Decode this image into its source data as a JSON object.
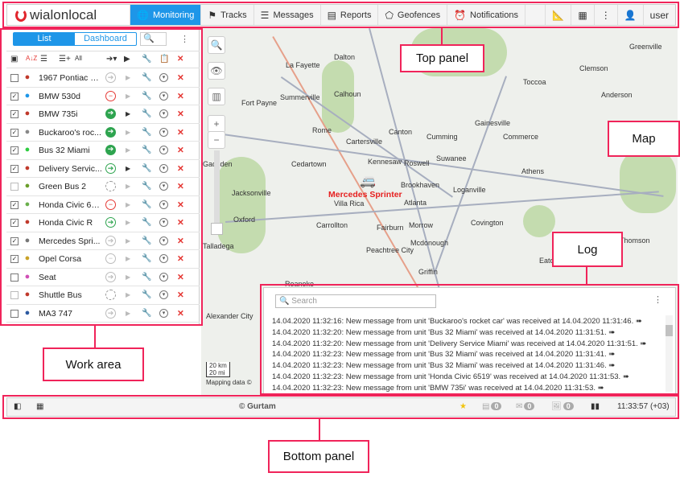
{
  "top_panel": {
    "logo": "wialonlocal",
    "nav": [
      {
        "label": "Monitoring",
        "icon": "globe-icon",
        "active": true
      },
      {
        "label": "Tracks",
        "icon": "flag-icon"
      },
      {
        "label": "Messages",
        "icon": "list-icon"
      },
      {
        "label": "Reports",
        "icon": "report-icon"
      },
      {
        "label": "Geofences",
        "icon": "geofence-icon"
      },
      {
        "label": "Notifications",
        "icon": "alarm-icon"
      }
    ],
    "user": "user"
  },
  "work_area": {
    "tabs": {
      "list": "List",
      "dashboard": "Dashboard"
    },
    "header_all": "All",
    "units": [
      {
        "name": "1967 Pontiac G...",
        "checked": false,
        "state": "idle",
        "color": "#c0392b"
      },
      {
        "name": "BMW 530d",
        "checked": true,
        "state": "stop",
        "color": "#1e96e8"
      },
      {
        "name": "BMW 735i",
        "checked": true,
        "state": "parked",
        "color": "#c0392b"
      },
      {
        "name": "Buckaroo's roc...",
        "checked": true,
        "state": "parked",
        "color": "#888"
      },
      {
        "name": "Bus 32 Miami",
        "checked": true,
        "state": "parked",
        "color": "#2ecc40"
      },
      {
        "name": "Delivery Servic...",
        "checked": true,
        "state": "moving",
        "color": "#c0392b"
      },
      {
        "name": "Green Bus 2",
        "checked": false,
        "state": "none",
        "color": "#6a9e2a"
      },
      {
        "name": "Honda Civic 6519",
        "checked": true,
        "state": "stop",
        "color": "#6ab04c"
      },
      {
        "name": "Honda Civic R",
        "checked": true,
        "state": "moving",
        "color": "#c0392b"
      },
      {
        "name": "Mercedes Spri...",
        "checked": true,
        "state": "idle",
        "color": "#777"
      },
      {
        "name": "Opel Corsa",
        "checked": true,
        "state": "offline",
        "color": "#c9a227"
      },
      {
        "name": "Seat",
        "checked": false,
        "state": "idle",
        "color": "#d04fb5"
      },
      {
        "name": "Shuttle Bus",
        "checked": false,
        "state": "none",
        "color": "#c0392b"
      },
      {
        "name": "MA3 747",
        "checked": false,
        "state": "idle",
        "color": "#2c5aa0"
      }
    ]
  },
  "map": {
    "unit_label": "Mercedes Sprinter",
    "cities": [
      "Dalton",
      "La Fayette",
      "Summerville",
      "Calhoun",
      "Fort Payne",
      "Rome",
      "Canton",
      "Cumming",
      "Gainesville",
      "Toccoa",
      "Clemson",
      "Anderson",
      "Greenville",
      "Cartersville",
      "Kennesaw",
      "Roswell",
      "Suwanee",
      "Commerce",
      "Athens",
      "Gadsden",
      "Cedartown",
      "Jacksonville",
      "Brookhaven",
      "Loganville",
      "Villa Rica",
      "Atlanta",
      "Oxford",
      "Carrollton",
      "Fairburn",
      "Morrow",
      "Covington",
      "Talladega",
      "Peachtree City",
      "Mcdonough",
      "Griffin",
      "Eatonton",
      "Alexander City",
      "Roanoke",
      "Thomson"
    ],
    "scale_km": "20 km",
    "scale_mi": "20 mi",
    "attribution": "Mapping data ©"
  },
  "log": {
    "search_placeholder": "Search",
    "lines": [
      "14.04.2020 11:32:16: New message from unit 'Buckaroo's rocket car' was received at 14.04.2020 11:31:46.",
      "14.04.2020 11:32:20: New message from unit 'Bus 32 Miami' was received at 14.04.2020 11:31:51.",
      "14.04.2020 11:32:20: New message from unit 'Delivery Service Miami' was received at 14.04.2020 11:31:51.",
      "14.04.2020 11:32:23: New message from unit 'Bus 32 Miami' was received at 14.04.2020 11:31:41.",
      "14.04.2020 11:32:23: New message from unit 'Bus 32 Miami' was received at 14.04.2020 11:31:46.",
      "14.04.2020 11:32:23: New message from unit 'Honda Civic 6519' was received at 14.04.2020 11:31:53.",
      "14.04.2020 11:32:23: New message from unit 'BMW 735i' was received at 14.04.2020 11:31:53."
    ]
  },
  "bottom_panel": {
    "copyright": "© Gurtam",
    "counts": [
      "0",
      "0",
      "0"
    ],
    "time": "11:33:57 (+03)"
  },
  "callouts": {
    "top": "Top panel",
    "map": "Map",
    "log": "Log",
    "work": "Work area",
    "bottom": "Bottom panel"
  }
}
